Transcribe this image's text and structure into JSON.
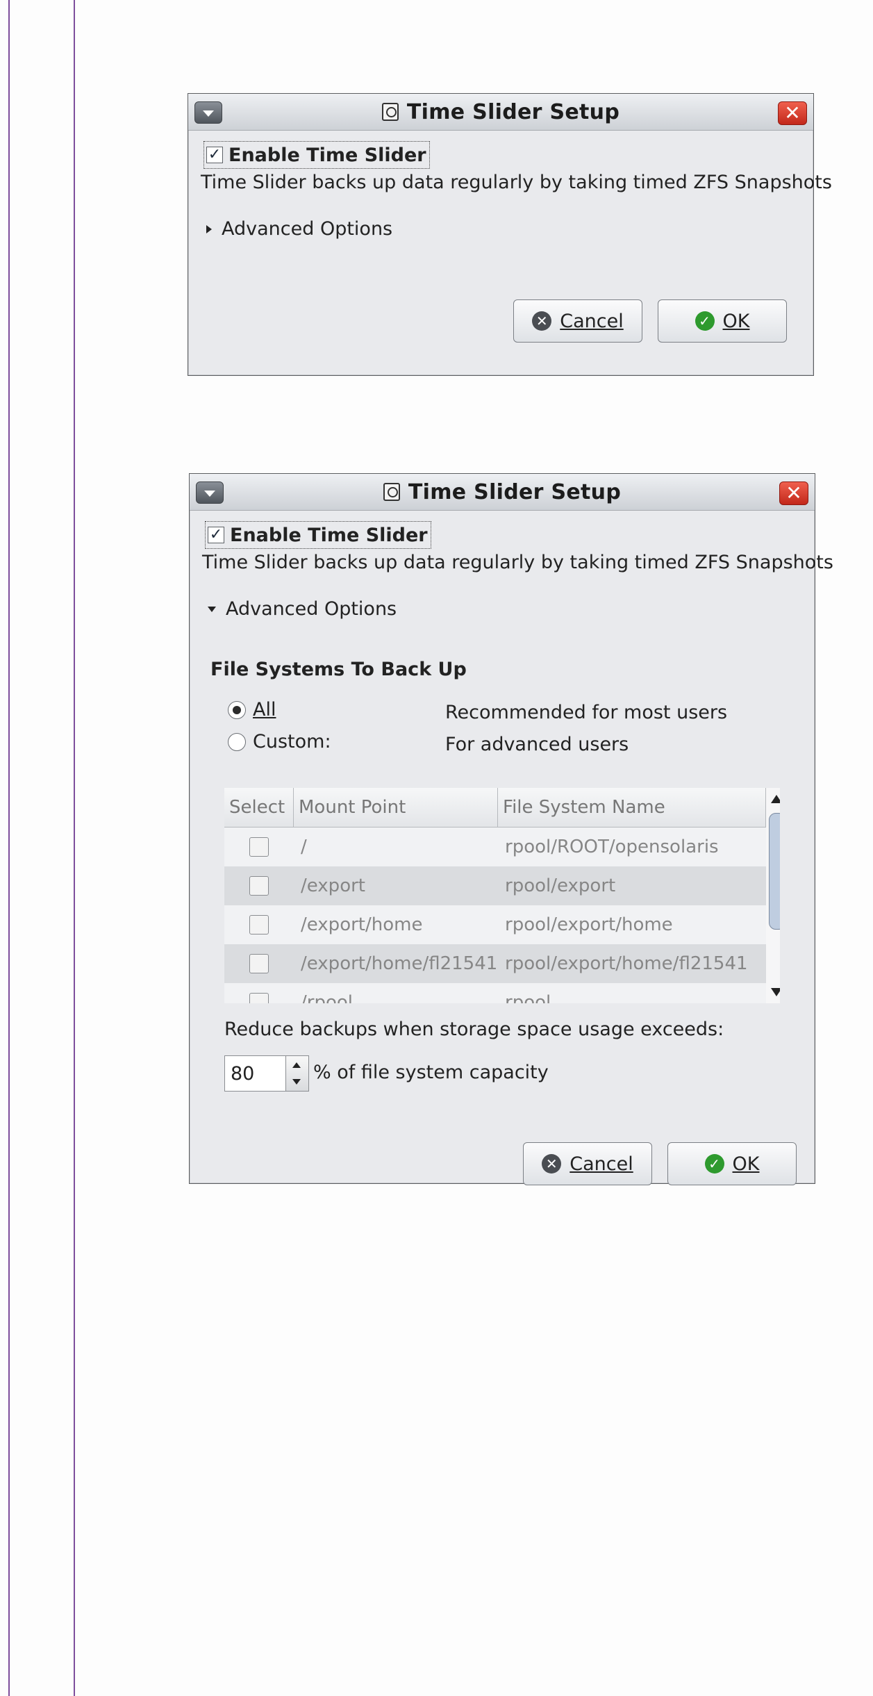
{
  "colors": {
    "margin_rule": "#7d4e9c",
    "close_button": "#d23a2a",
    "ok_icon": "#2e9a2e"
  },
  "dialog_collapsed": {
    "title": "Time Slider Setup",
    "enable_label": "Enable Time Slider",
    "enable_checked": true,
    "description": "Time Slider backs up data regularly by taking timed ZFS Snapshots",
    "advanced_label": "Advanced Options",
    "cancel_label": "Cancel",
    "ok_label": "OK"
  },
  "dialog_expanded": {
    "title": "Time Slider Setup",
    "enable_label": "Enable Time Slider",
    "enable_checked": true,
    "description": "Time Slider backs up data regularly by taking timed ZFS Snapshots",
    "advanced_label": "Advanced Options",
    "section_title": "File Systems To Back Up",
    "radio_all_label": "All",
    "radio_all_desc": "Recommended for most users",
    "radio_custom_label": "Custom:",
    "radio_custom_desc": "For advanced users",
    "table": {
      "headers": [
        "Select",
        "Mount Point",
        "File System Name"
      ],
      "rows": [
        {
          "mount": "/",
          "fs": "rpool/ROOT/opensolaris"
        },
        {
          "mount": "/export",
          "fs": "rpool/export"
        },
        {
          "mount": "/export/home",
          "fs": "rpool/export/home"
        },
        {
          "mount": "/export/home/fl21541",
          "fs": "rpool/export/home/fl21541"
        },
        {
          "mount": "/rpool",
          "fs": "rpool"
        }
      ]
    },
    "reduce_label": "Reduce backups when storage space usage exceeds:",
    "capacity_value": "80",
    "capacity_suffix": "% of file system capacity",
    "cancel_label": "Cancel",
    "ok_label": "OK"
  }
}
